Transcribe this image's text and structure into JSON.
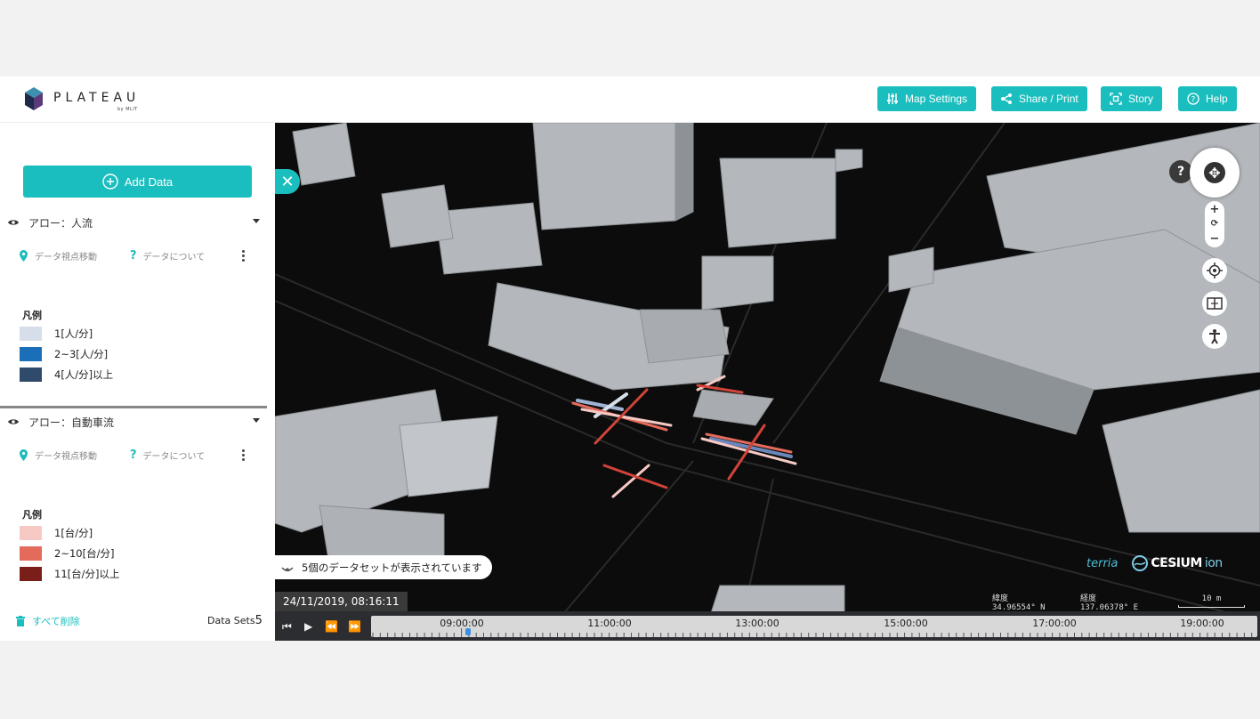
{
  "app": {
    "brand": "PLATEAU",
    "brand_sub": "by MLIT"
  },
  "header": {
    "map_settings": "Map Settings",
    "share_print": "Share / Print",
    "story": "Story",
    "help": "Help"
  },
  "sidebar": {
    "add_data": "Add Data",
    "layers": [
      {
        "title": "アロー：人流",
        "action_move": "データ視点移動",
        "action_about": "データについて",
        "legend_title": "凡例",
        "legend": [
          {
            "label": "1[人/分]",
            "color": "#d6dfe9"
          },
          {
            "label": "2~3[人/分]",
            "color": "#1a6fb8"
          },
          {
            "label": "4[人/分]以上",
            "color": "#2f4a6b"
          }
        ]
      },
      {
        "title": "アロー：自動車流",
        "action_move": "データ視点移動",
        "action_about": "データについて",
        "legend_title": "凡例",
        "legend": [
          {
            "label": "1[台/分]",
            "color": "#f7c9c4"
          },
          {
            "label": "2~10[台/分]",
            "color": "#e46a5c"
          },
          {
            "label": "11[台/分]以上",
            "color": "#7a1e1a"
          }
        ]
      }
    ],
    "clear_all": "すべて削除",
    "datasets_label": "Data Sets",
    "datasets_count": "5"
  },
  "map": {
    "notice": "5個のデータセットが表示されています",
    "datetime": "24/11/2019, 08:16:11",
    "lat_label": "緯度",
    "lat_value": "34.96554° N",
    "lon_label": "経度",
    "lon_value": "137.06378° E",
    "scale": "10 m",
    "credit_terria": "terria",
    "credit_cesium": "CESIUM",
    "credit_ion": "ion",
    "help_q": "?"
  },
  "timeline": {
    "ticks": [
      "09:00:00",
      "11:00:00",
      "13:00:00",
      "15:00:00",
      "17:00:00",
      "19:00:00"
    ]
  },
  "colors": {
    "accent": "#1bbebe"
  }
}
